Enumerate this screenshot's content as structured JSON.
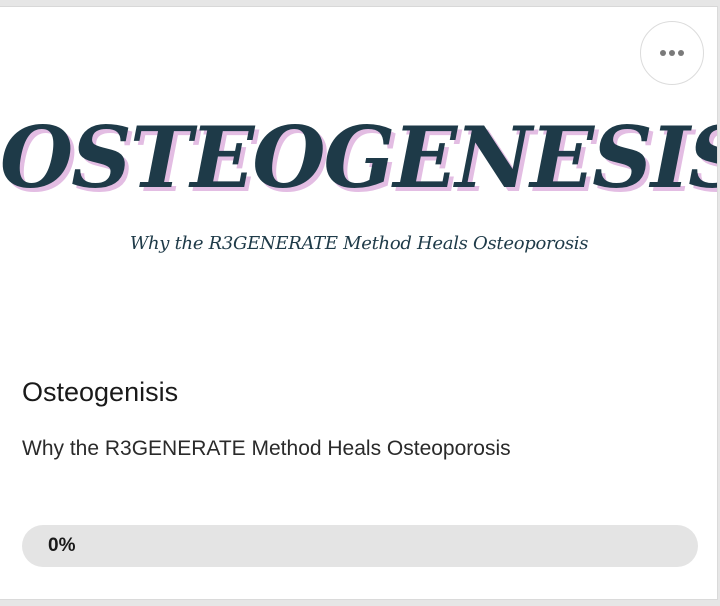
{
  "card": {
    "menu_icon": "more-horizontal-icon",
    "cover": {
      "title": "OSTEOGENESIS",
      "subtitle": "Why the R3GENERATE Method Heals Osteoporosis",
      "title_color": "#1e3a48",
      "title_shadow_color": "#e3bde3"
    },
    "title": "Osteogenisis",
    "description": "Why the R3GENERATE Method Heals Osteoporosis",
    "progress": {
      "label": "0%",
      "value": 0
    }
  }
}
